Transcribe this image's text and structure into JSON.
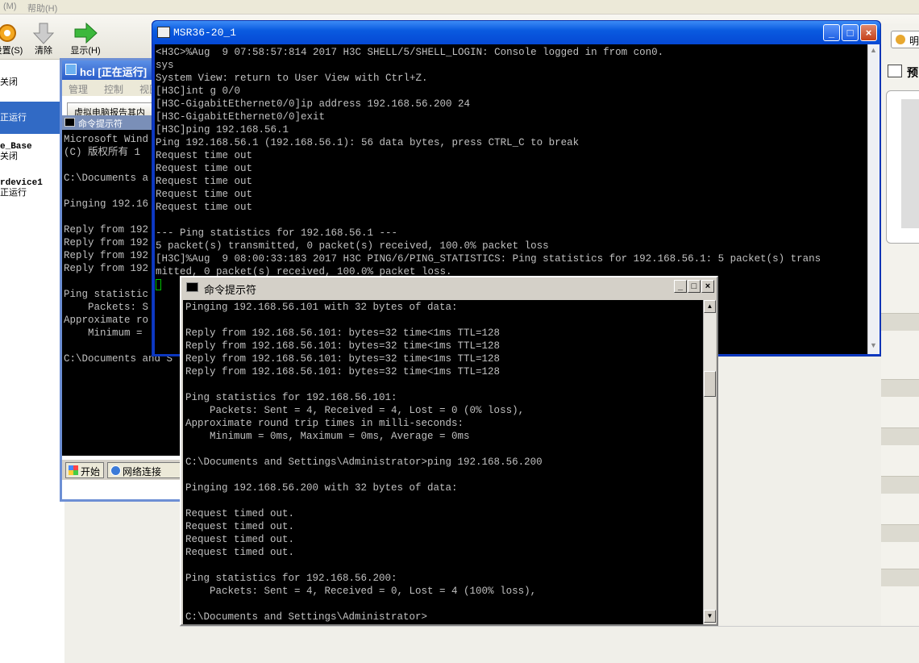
{
  "vbox": {
    "menu": {
      "m": "(M)",
      "help": "帮助(H)"
    },
    "toolbar": {
      "settings": "设置(S)",
      "clear": "清除",
      "show": "显示(H)"
    },
    "vm_list": [
      {
        "name": "",
        "state": "关闭"
      },
      {
        "name": "",
        "state": "正运行"
      },
      {
        "name": "e_Base",
        "state": "关闭"
      },
      {
        "name": "rdevice1",
        "state": "正运行"
      }
    ],
    "right": {
      "preview_btn": "明",
      "preview_label": "预"
    }
  },
  "hcl": {
    "title": "hcl [正在运行]",
    "menu": [
      "管理",
      "控制",
      "视图"
    ],
    "tab": "虚拟电脑报告其内",
    "cmd_title": "命令提示符",
    "console_lines": [
      "Microsoft Wind",
      "(C) 版权所有 1",
      "",
      "C:\\Documents a",
      "",
      "Pinging 192.16",
      "",
      "Reply from 192",
      "Reply from 192",
      "Reply from 192",
      "Reply from 192",
      "",
      "Ping statistic",
      "    Packets: S",
      "Approximate ro",
      "    Minimum =",
      "",
      "C:\\Documents and S"
    ],
    "taskbar": {
      "start": "开始",
      "network": "网络连接"
    }
  },
  "msr": {
    "title": "MSR36-20_1",
    "console_lines": [
      "<H3C>%Aug  9 07:58:57:814 2017 H3C SHELL/5/SHELL_LOGIN: Console logged in from con0.",
      "sys",
      "System View: return to User View with Ctrl+Z.",
      "[H3C]int g 0/0",
      "[H3C-GigabitEthernet0/0]ip address 192.168.56.200 24",
      "[H3C-GigabitEthernet0/0]exit",
      "[H3C]ping 192.168.56.1",
      "Ping 192.168.56.1 (192.168.56.1): 56 data bytes, press CTRL_C to break",
      "Request time out",
      "Request time out",
      "Request time out",
      "Request time out",
      "Request time out",
      "",
      "--- Ping statistics for 192.168.56.1 ---",
      "5 packet(s) transmitted, 0 packet(s) received, 100.0% packet loss",
      "[H3C]%Aug  9 08:00:33:183 2017 H3C PING/6/PING_STATISTICS: Ping statistics for 192.168.56.1: 5 packet(s) trans",
      "mitted, 0 packet(s) received, 100.0% packet loss."
    ]
  },
  "cmd": {
    "title": "命令提示符",
    "console_lines": [
      "Pinging 192.168.56.101 with 32 bytes of data:",
      "",
      "Reply from 192.168.56.101: bytes=32 time<1ms TTL=128",
      "Reply from 192.168.56.101: bytes=32 time<1ms TTL=128",
      "Reply from 192.168.56.101: bytes=32 time<1ms TTL=128",
      "Reply from 192.168.56.101: bytes=32 time<1ms TTL=128",
      "",
      "Ping statistics for 192.168.56.101:",
      "    Packets: Sent = 4, Received = 4, Lost = 0 (0% loss),",
      "Approximate round trip times in milli-seconds:",
      "    Minimum = 0ms, Maximum = 0ms, Average = 0ms",
      "",
      "C:\\Documents and Settings\\Administrator>ping 192.168.56.200",
      "",
      "Pinging 192.168.56.200 with 32 bytes of data:",
      "",
      "Request timed out.",
      "Request timed out.",
      "Request timed out.",
      "Request timed out.",
      "",
      "Ping statistics for 192.168.56.200:",
      "    Packets: Sent = 4, Received = 0, Lost = 4 (100% loss),",
      "",
      "C:\\Documents and Settings\\Administrator>"
    ]
  },
  "window_buttons": {
    "minimize": "_",
    "maximize": "□",
    "close": "×"
  },
  "colors": {
    "console_bg": "#000000",
    "console_fg": "#c0c0c0",
    "xp_title": "#0a5be0",
    "selection": "#316ac5",
    "cursor": "#00c000"
  }
}
